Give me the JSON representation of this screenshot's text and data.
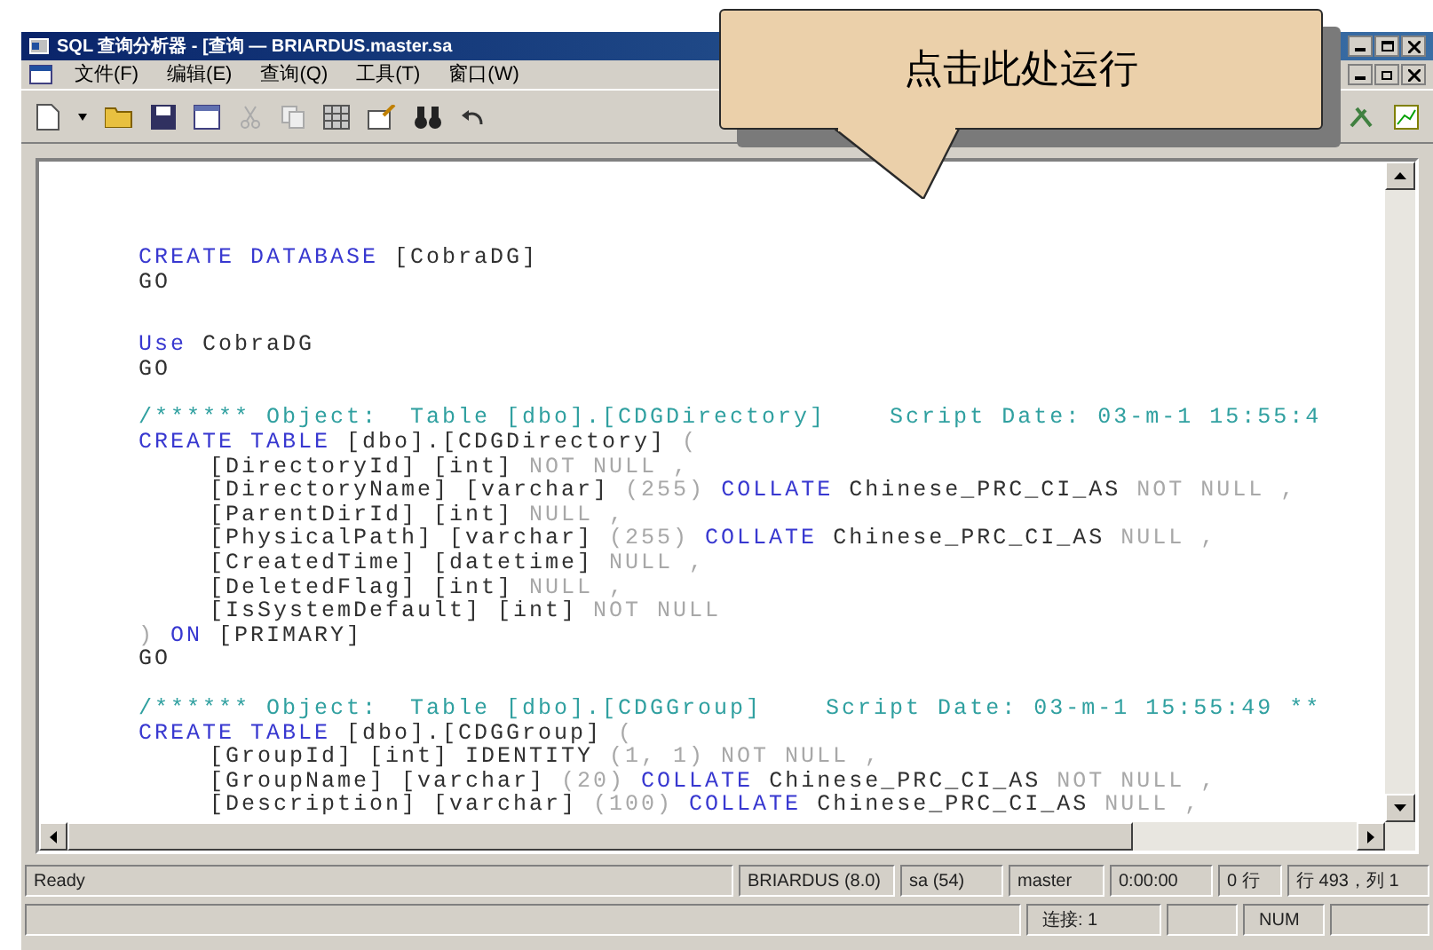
{
  "window": {
    "title": "SQL 查询分析器 - [查询 — BRIARDUS.master.sa"
  },
  "menu": [
    "文件(F)",
    "编辑(E)",
    "查询(Q)",
    "工具(T)",
    "窗口(W)"
  ],
  "code_blocks": [
    {
      "lines": [
        {
          "tokens": [
            {
              "kind": "keyword",
              "text": "CREATE DATABASE"
            },
            {
              "kind": "plain",
              "text": " [CobraDG]"
            }
          ]
        },
        {
          "tokens": [
            {
              "kind": "plain",
              "text": "GO"
            }
          ]
        }
      ]
    },
    {
      "lines": [
        {
          "tokens": [
            {
              "kind": "keyword",
              "text": "Use"
            },
            {
              "kind": "plain",
              "text": " CobraDG"
            }
          ]
        },
        {
          "tokens": [
            {
              "kind": "plain",
              "text": "GO"
            }
          ]
        }
      ]
    },
    {
      "lines": [
        {
          "tokens": [
            {
              "kind": "comment",
              "text": "/****** Object:  Table [dbo].[CDGDirectory]    Script Date: 03-m-1 15:55:4"
            }
          ]
        },
        {
          "tokens": [
            {
              "kind": "keyword",
              "text": "CREATE TABLE"
            },
            {
              "kind": "plain",
              "text": " [dbo].[CDGDirectory] "
            },
            {
              "kind": "muted",
              "text": "("
            }
          ],
          "children": [
            {
              "tokens": [
                {
                  "kind": "plain",
                  "text": "[DirectoryId] [int] "
                },
                {
                  "kind": "muted",
                  "text": "NOT NULL ,"
                }
              ]
            },
            {
              "tokens": [
                {
                  "kind": "plain",
                  "text": "[DirectoryName] [varchar] "
                },
                {
                  "kind": "muted",
                  "text": "(255) "
                },
                {
                  "kind": "keyword",
                  "text": "COLLATE"
                },
                {
                  "kind": "plain",
                  "text": " Chinese_PRC_CI_AS "
                },
                {
                  "kind": "muted",
                  "text": "NOT NULL ,"
                }
              ]
            },
            {
              "tokens": [
                {
                  "kind": "plain",
                  "text": "[ParentDirId] [int] "
                },
                {
                  "kind": "muted",
                  "text": "NULL ,"
                }
              ]
            },
            {
              "tokens": [
                {
                  "kind": "plain",
                  "text": "[PhysicalPath] [varchar] "
                },
                {
                  "kind": "muted",
                  "text": "(255) "
                },
                {
                  "kind": "keyword",
                  "text": "COLLATE"
                },
                {
                  "kind": "plain",
                  "text": " Chinese_PRC_CI_AS "
                },
                {
                  "kind": "muted",
                  "text": "NULL ,"
                }
              ]
            },
            {
              "tokens": [
                {
                  "kind": "plain",
                  "text": "[CreatedTime] [datetime] "
                },
                {
                  "kind": "muted",
                  "text": "NULL ,"
                }
              ]
            },
            {
              "tokens": [
                {
                  "kind": "plain",
                  "text": "[DeletedFlag] [int] "
                },
                {
                  "kind": "muted",
                  "text": "NULL ,"
                }
              ]
            },
            {
              "tokens": [
                {
                  "kind": "plain",
                  "text": "[IsSystemDefault] [int] "
                },
                {
                  "kind": "muted",
                  "text": "NOT NULL"
                }
              ]
            }
          ]
        },
        {
          "tokens": [
            {
              "kind": "muted",
              "text": ") "
            },
            {
              "kind": "keyword",
              "text": "ON"
            },
            {
              "kind": "plain",
              "text": " [PRIMARY]"
            }
          ]
        },
        {
          "tokens": [
            {
              "kind": "plain",
              "text": "GO"
            }
          ]
        }
      ]
    },
    {
      "lines": [
        {
          "tokens": [
            {
              "kind": "comment",
              "text": "/****** Object:  Table [dbo].[CDGGroup]    Script Date: 03-m-1 15:55:49 **"
            }
          ]
        },
        {
          "tokens": [
            {
              "kind": "keyword",
              "text": "CREATE TABLE"
            },
            {
              "kind": "plain",
              "text": " [dbo].[CDGGroup] "
            },
            {
              "kind": "muted",
              "text": "("
            }
          ],
          "children": [
            {
              "tokens": [
                {
                  "kind": "plain",
                  "text": "[GroupId] [int] IDENTITY "
                },
                {
                  "kind": "muted",
                  "text": "(1, 1) NOT NULL ,"
                }
              ]
            },
            {
              "tokens": [
                {
                  "kind": "plain",
                  "text": "[GroupName] [varchar] "
                },
                {
                  "kind": "muted",
                  "text": "(20) "
                },
                {
                  "kind": "keyword",
                  "text": "COLLATE"
                },
                {
                  "kind": "plain",
                  "text": " Chinese_PRC_CI_AS "
                },
                {
                  "kind": "muted",
                  "text": "NOT NULL ,"
                }
              ]
            },
            {
              "tokens": [
                {
                  "kind": "plain",
                  "text": "[Description] [varchar] "
                },
                {
                  "kind": "muted",
                  "text": "(100) "
                },
                {
                  "kind": "keyword",
                  "text": "COLLATE"
                },
                {
                  "kind": "plain",
                  "text": " Chinese_PRC_CI_AS "
                },
                {
                  "kind": "muted",
                  "text": "NULL ,"
                }
              ]
            }
          ]
        }
      ]
    }
  ],
  "status_bar": [
    "Ready",
    "BRIARDUS (8.0)",
    "sa (54)",
    "master",
    "0:00:00",
    "0 行",
    "行 493，列 1"
  ],
  "status_bar_2": [
    "连接: 1",
    "NUM"
  ],
  "callout": {
    "text": "点击此处运行"
  }
}
